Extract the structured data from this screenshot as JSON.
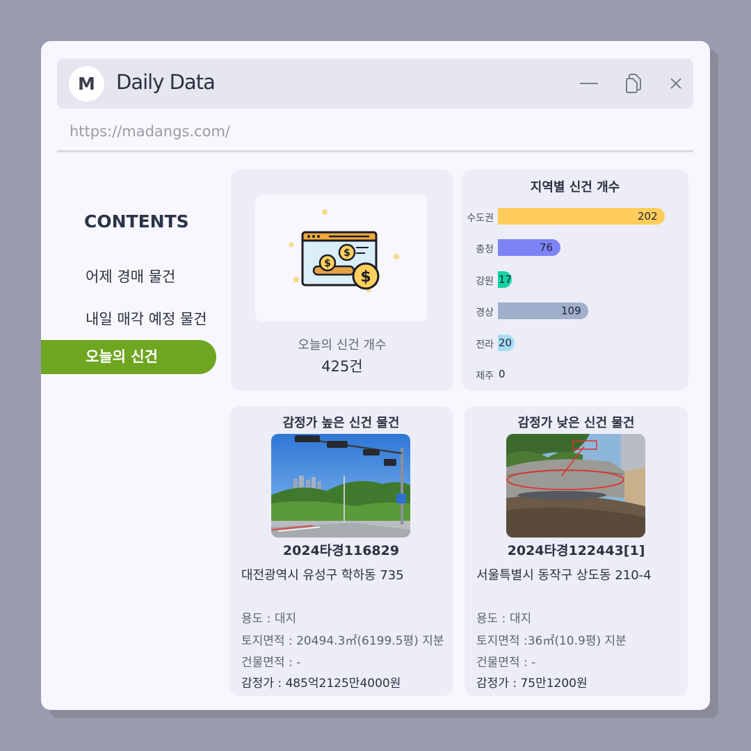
{
  "window": {
    "logo_letter": "M",
    "title": "Daily Data",
    "url": "https://madangs.com/"
  },
  "sidebar": {
    "heading": "CONTENTS",
    "items": [
      {
        "label": "어제 경매 물건",
        "active": false
      },
      {
        "label": "내일 매각 예정 물건",
        "active": false
      },
      {
        "label": "오늘의 신건",
        "active": true
      }
    ]
  },
  "summary": {
    "label": "오늘의 신건 개수",
    "value": "425건",
    "icon": "money-window-icon"
  },
  "chart_data": {
    "type": "bar",
    "orientation": "horizontal",
    "title": "지역별 신건 개수",
    "categories": [
      "수도권",
      "충청",
      "강원",
      "경상",
      "전라",
      "제주"
    ],
    "values": [
      202,
      76,
      17,
      109,
      20,
      0
    ],
    "colors": [
      "#ffcd5c",
      "#7d82f5",
      "#12d4a0",
      "#9fafcc",
      "#a8dcf5",
      "#cccccc"
    ],
    "xlim": [
      0,
      202
    ],
    "grid": false
  },
  "high_item": {
    "heading": "감정가 높은 신건 물건",
    "case_no": "2024타경116829",
    "address": "대전광역시 유성구 학하동 735",
    "usage": "용도 :  대지",
    "land_area": "토지면적 : 20494.3㎡(6199.5평) 지분",
    "building_area": "건물면적 : -",
    "appraisal": "감정가 : 485억2125만4000원"
  },
  "low_item": {
    "heading": "감정가 낮은 신건 물건",
    "case_no": "2024타경122443[1]",
    "address": "서울특별시 동작구 상도동 210-4",
    "usage": "용도 : 대지",
    "land_area": "토지면적 :36㎡(10.9평) 지분",
    "building_area": "건물면적 : -",
    "appraisal": "감정가 : 75만1200원"
  },
  "colors": {
    "accent_green": "#6ea521",
    "card_bg": "#ecedf6",
    "window_bg": "#f7f7fd"
  }
}
